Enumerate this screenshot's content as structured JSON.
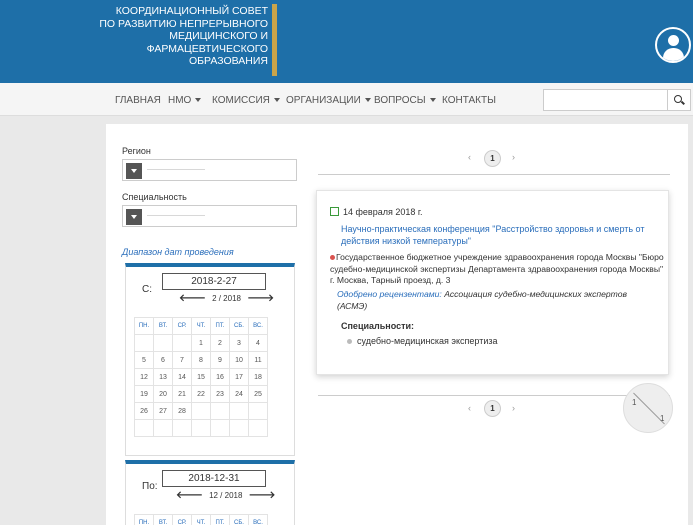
{
  "header": {
    "logo_lines": [
      "КООРДИНАЦИОННЫЙ СОВЕТ",
      "ПО РАЗВИТИЮ НЕПРЕРЫВНОГО",
      "МЕДИЦИНСКОГО И",
      "ФАРМАЦЕВТИЧЕСКОГО",
      "ОБРАЗОВАНИЯ"
    ],
    "user_icon": "user-icon"
  },
  "nav": {
    "items": [
      {
        "label": "ГЛАВНАЯ",
        "dropdown": false
      },
      {
        "label": "НМО",
        "dropdown": true
      },
      {
        "label": "КОМИССИЯ",
        "dropdown": true
      },
      {
        "label": "ОРГАНИЗАЦИИ",
        "dropdown": true
      },
      {
        "label": "ВОПРОСЫ",
        "dropdown": true
      },
      {
        "label": "КОНТАКТЫ",
        "dropdown": false
      }
    ],
    "search": {
      "placeholder": "",
      "value": "",
      "icon": "search-icon"
    }
  },
  "filters": {
    "region_label": "Регион",
    "region_value": "-----------------------------",
    "specialty_label": "Специальность",
    "specialty_value": "-----------------------------",
    "date_range_label": "Диапазон дат проведения"
  },
  "calendar_from": {
    "label": "С:",
    "date": "2018-2-27",
    "month": "2 / 2018",
    "weekdays": [
      "ПН.",
      "ВТ.",
      "СР.",
      "ЧТ.",
      "ПТ.",
      "СБ.",
      "ВС."
    ],
    "rows": [
      [
        "",
        "",
        "",
        "1",
        "2",
        "3",
        "4"
      ],
      [
        "5",
        "6",
        "7",
        "8",
        "9",
        "10",
        "11"
      ],
      [
        "12",
        "13",
        "14",
        "15",
        "16",
        "17",
        "18"
      ],
      [
        "19",
        "20",
        "21",
        "22",
        "23",
        "24",
        "25"
      ],
      [
        "26",
        "27",
        "28",
        "",
        "",
        "",
        ""
      ],
      [
        "",
        "",
        "",
        "",
        "",
        "",
        ""
      ]
    ]
  },
  "calendar_to": {
    "label": "По:",
    "date": "2018-12-31",
    "month": "12 / 2018",
    "weekdays": [
      "ПН.",
      "ВТ.",
      "СР.",
      "ЧТ.",
      "ПТ.",
      "СБ.",
      "ВС."
    ]
  },
  "pagination": {
    "prev": "‹",
    "next": "›",
    "current": "1"
  },
  "event": {
    "date": "14 февраля 2018 г.",
    "title": "Научно-практическая конференция \"Расстройство здоровья и смерть от действия низкой температуры\"",
    "organization": "Государственное бюджетное учреждение здравоохранения города Москвы \"Бюро судебно-медицинской экспертизы Департамента здравоохранения города Москвы\" г. Москва, Тарный проезд, д. 3",
    "approved_label": "Одобрено рецензентами:",
    "approved_by": "Ассоциация судебно-медицинских экспертов (АСМЭ)",
    "specialties_label": "Специальности:",
    "specialties": [
      "судебно-медицинская экспертиза"
    ]
  },
  "page_badge": {
    "current": "1",
    "total": "1"
  },
  "colors": {
    "header_bg": "#1e6fa8",
    "accent_bar": "#c9a44a",
    "link": "#2a6ebb"
  }
}
